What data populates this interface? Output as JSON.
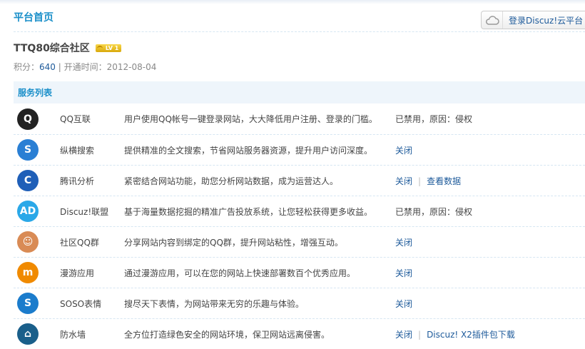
{
  "header": {
    "title": "平台首页",
    "cloud_button": "登录Discuz!云平台"
  },
  "site": {
    "name": "TTQ80综合社区",
    "level": "LV 1",
    "points_label": "积分：",
    "points": "640",
    "divider": "|",
    "open_label": "开通时间：",
    "open_date": "2012-08-04"
  },
  "list": {
    "title": "服务列表",
    "rows": [
      {
        "name": "QQ互联",
        "desc": "用户使用QQ帐号一键登录网站，大大降低用户注册、登录的门槛。",
        "status": "已禁用，原因：侵权",
        "links": [],
        "icon": "qq-penguin-icon",
        "color": "#222"
      },
      {
        "name": "纵横搜索",
        "desc": "提供精准的全文搜索，节省网站服务器资源，提升用户访问深度。",
        "links": [
          "关闭"
        ],
        "icon": "soso-search-icon",
        "color": "#2a7fd4"
      },
      {
        "name": "腾讯分析",
        "desc": "紧密结合网站功能，助您分析网站数据，成为运营达人。",
        "links": [
          "关闭",
          "查看数据"
        ],
        "icon": "analytics-icon",
        "color": "#1f5fb8"
      },
      {
        "name": "Discuz!联盟",
        "desc": "基于海量数据挖掘的精准广告投放系统，让您轻松获得更多收益。",
        "status": "已禁用，原因：侵权",
        "links": [],
        "icon": "ad-icon",
        "color": "#2aa8e8"
      },
      {
        "name": "社区QQ群",
        "desc": "分享网站内容到绑定的QQ群，提升网站粘性，增强互动。",
        "links": [
          "关闭"
        ],
        "icon": "qq-group-icon",
        "color": "#d98b55"
      },
      {
        "name": "漫游应用",
        "desc": "通过漫游应用，可以在您的网站上快速部署数百个优秀应用。",
        "links": [
          "关闭"
        ],
        "icon": "manyou-icon",
        "color": "#f08a00"
      },
      {
        "name": "SOSO表情",
        "desc": "搜尽天下表情，为网站带来无穷的乐趣与体验。",
        "links": [
          "关闭"
        ],
        "icon": "soso-emoji-icon",
        "color": "#1b7ccc"
      },
      {
        "name": "防水墙",
        "desc": "全方位打造绿色安全的网站环境，保卫网站远离侵害。",
        "links": [
          "关闭",
          "Discuz! X2插件包下载"
        ],
        "icon": "shield-icon",
        "color": "#1a5f8a"
      }
    ]
  },
  "icon_glyphs": [
    "Q",
    "S",
    "C",
    "AD",
    "☺",
    "m",
    "S",
    "⌂"
  ]
}
